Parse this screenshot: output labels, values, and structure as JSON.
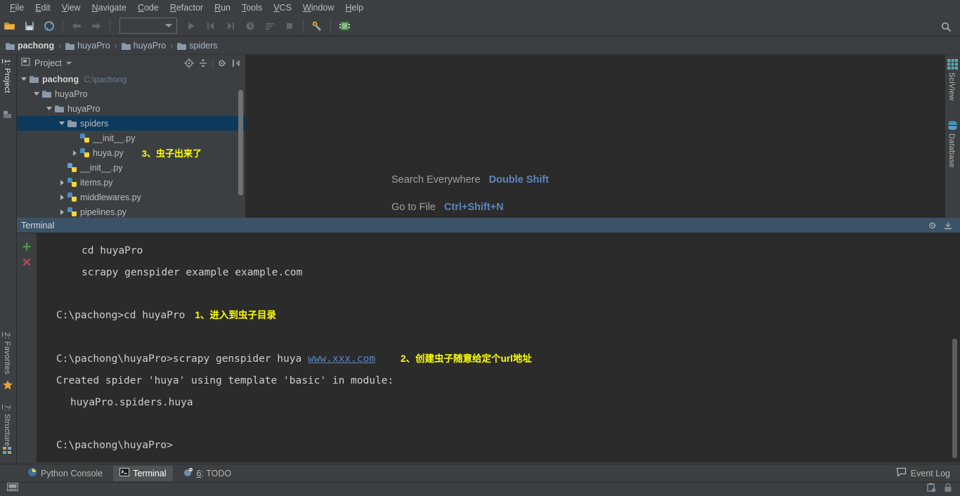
{
  "menu": {
    "items": [
      {
        "label": "File",
        "mnemonic": "F"
      },
      {
        "label": "Edit",
        "mnemonic": "E"
      },
      {
        "label": "View",
        "mnemonic": "V"
      },
      {
        "label": "Navigate",
        "mnemonic": "N"
      },
      {
        "label": "Code",
        "mnemonic": "C"
      },
      {
        "label": "Refactor",
        "mnemonic": "R"
      },
      {
        "label": "Run",
        "mnemonic": "R"
      },
      {
        "label": "Tools",
        "mnemonic": "T"
      },
      {
        "label": "VCS",
        "mnemonic": "V"
      },
      {
        "label": "Window",
        "mnemonic": "W"
      },
      {
        "label": "Help",
        "mnemonic": "H"
      }
    ]
  },
  "toolbar": {
    "icons": [
      "open-folder-icon",
      "save-all-icon",
      "sync-icon",
      "back-arrow-icon",
      "forward-arrow-icon"
    ],
    "run_config_value": "",
    "run_icons": [
      "run-icon",
      "rerun-icon",
      "step-icon",
      "debug-icon",
      "coverage-icon",
      "stop-icon"
    ],
    "right_icons": [
      "settings-wrench-icon",
      "python-package-icon"
    ],
    "search_icon": "search-icon"
  },
  "breadcrumb": {
    "items": [
      {
        "label": "pachong",
        "icon": "folder-icon",
        "bold": true
      },
      {
        "label": "huyaPro",
        "icon": "folder-icon",
        "bold": false
      },
      {
        "label": "huyaPro",
        "icon": "folder-icon",
        "bold": false
      },
      {
        "label": "spiders",
        "icon": "folder-icon",
        "bold": false
      }
    ],
    "separator": "›"
  },
  "left_stripe": {
    "tabs": [
      {
        "label": "1: Project",
        "mnemonic": "1",
        "selected": true
      },
      {
        "label": "2: Favorites",
        "mnemonic": "2",
        "selected": false
      },
      {
        "label": "7: Structure",
        "mnemonic": "7",
        "selected": false
      }
    ]
  },
  "right_stripe": {
    "tabs": [
      {
        "label": "SciView",
        "icon": "grid-icon"
      },
      {
        "label": "Database",
        "icon": "database-icon"
      }
    ]
  },
  "project_panel": {
    "title": "Project",
    "tool_icons": [
      "locate-target-icon",
      "collapse-all-icon",
      "gear-icon",
      "hide-panel-icon"
    ],
    "tree": [
      {
        "label": "pachong",
        "path": "C:\\pachong",
        "depth": 0,
        "arrow": "down",
        "icon": "folder-icon",
        "bold": true,
        "selected": false
      },
      {
        "label": "huyaPro",
        "path": "",
        "depth": 1,
        "arrow": "down",
        "icon": "folder-icon",
        "bold": false,
        "selected": false
      },
      {
        "label": "huyaPro",
        "path": "",
        "depth": 2,
        "arrow": "down",
        "icon": "folder-icon",
        "bold": false,
        "selected": false
      },
      {
        "label": "spiders",
        "path": "",
        "depth": 3,
        "arrow": "down",
        "icon": "folder-icon",
        "bold": false,
        "selected": true
      },
      {
        "label": "__init__.py",
        "path": "",
        "depth": 4,
        "arrow": "none",
        "icon": "python-file-icon",
        "bold": false,
        "selected": false
      },
      {
        "label": "huya.py",
        "path": "",
        "depth": 4,
        "arrow": "right",
        "icon": "python-file-icon",
        "bold": false,
        "selected": false,
        "annotation": "3、虫子出来了"
      },
      {
        "label": "__init__.py",
        "path": "",
        "depth": 3,
        "arrow": "none",
        "icon": "python-module-icon",
        "bold": false,
        "selected": false
      },
      {
        "label": "items.py",
        "path": "",
        "depth": 3,
        "arrow": "right",
        "icon": "python-file-icon",
        "bold": false,
        "selected": false
      },
      {
        "label": "middlewares.py",
        "path": "",
        "depth": 3,
        "arrow": "right",
        "icon": "python-file-icon",
        "bold": false,
        "selected": false
      },
      {
        "label": "pipelines.py",
        "path": "",
        "depth": 3,
        "arrow": "right",
        "icon": "python-file-icon",
        "bold": false,
        "selected": false
      }
    ]
  },
  "editor": {
    "hints": [
      {
        "label": "Search Everywhere",
        "key": "Double Shift"
      },
      {
        "label": "Go to File",
        "key": "Ctrl+Shift+N"
      }
    ]
  },
  "terminal": {
    "title": "Terminal",
    "tool_icons": [
      "gear-icon",
      "hide-panel-icon"
    ],
    "gutter_icons": [
      "new-session-plus-icon",
      "close-session-x-icon"
    ],
    "lines": [
      {
        "text": "cd huyaPro",
        "style": "indent"
      },
      {
        "text": "scrapy genspider example example.com",
        "style": "indent"
      },
      {
        "text": "",
        "style": "plain"
      },
      {
        "text": "",
        "style": "plain"
      },
      {
        "text": "C:\\pachong>cd huyaPro",
        "style": "plain",
        "note": "1、进入到虫子目录"
      },
      {
        "text": "",
        "style": "plain"
      },
      {
        "text": "C:\\pachong\\huyaPro>scrapy genspider huya ",
        "style": "link",
        "link_text": "www.xxx.com",
        "note": "2、创建虫子随意给定个url地址"
      },
      {
        "text": "Created spider 'huya' using template 'basic' in module:",
        "style": "plain"
      },
      {
        "text": "huyaPro.spiders.huya",
        "style": "indent2"
      },
      {
        "text": "",
        "style": "plain"
      },
      {
        "text": "",
        "style": "plain"
      },
      {
        "text": "C:\\pachong\\huyaPro>",
        "style": "plain"
      }
    ]
  },
  "bottom_bar": {
    "tabs": [
      {
        "label": "Python Console",
        "icon": "python-console-icon",
        "active": false,
        "mnemonic": ""
      },
      {
        "label": "Terminal",
        "icon": "terminal-icon",
        "active": true,
        "mnemonic": ""
      },
      {
        "label": "6: TODO",
        "icon": "todo-icon",
        "active": false,
        "mnemonic": "6"
      }
    ],
    "event_log": {
      "label": "Event Log",
      "icon": "event-log-icon"
    }
  },
  "status_bar": {
    "left_icon": "memory-indicator-icon",
    "right_icons": [
      "clipboard-icon",
      "lock-icon"
    ]
  },
  "colors": {
    "background": "#3c3f41",
    "editor_background": "#2b2b2b",
    "selection": "#0d3a5c",
    "terminal_header": "#3c5267",
    "accent_link": "#5c86c0",
    "annotation": "#ffff00",
    "text": "#bbbbbb"
  }
}
